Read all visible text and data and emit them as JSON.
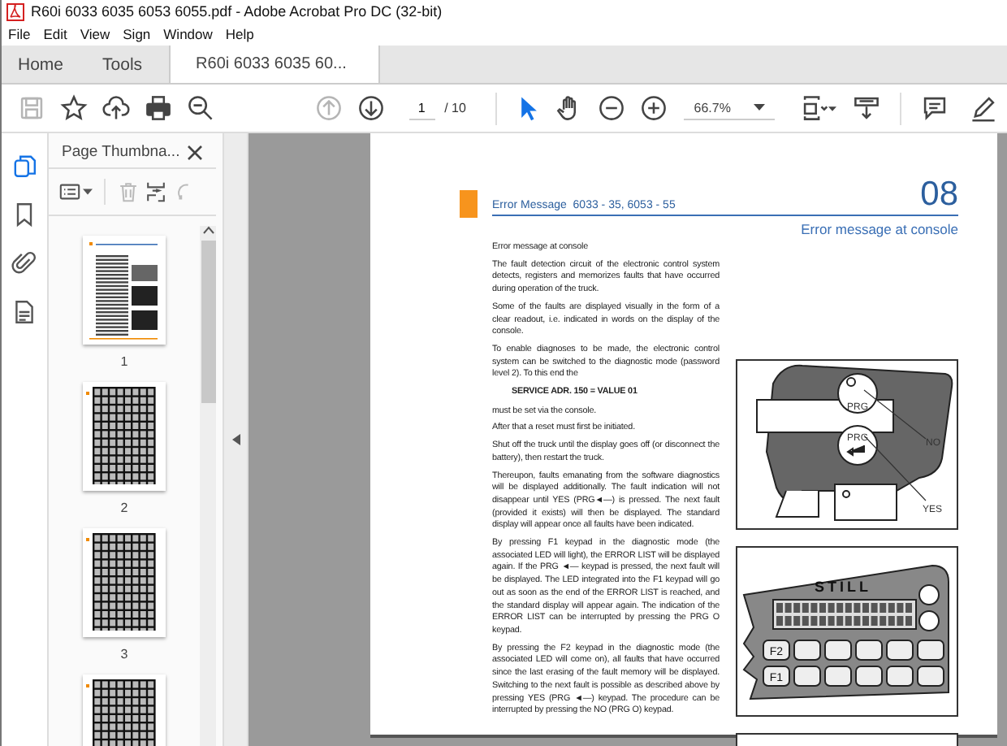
{
  "window": {
    "title": "R60i 6033 6035 6053 6055.pdf - Adobe Acrobat Pro DC (32-bit)"
  },
  "menu": [
    "File",
    "Edit",
    "View",
    "Sign",
    "Window",
    "Help"
  ],
  "tabs": [
    {
      "label": "Home",
      "selected": false,
      "kind": "nav"
    },
    {
      "label": "Tools",
      "selected": false,
      "kind": "nav"
    },
    {
      "label": "R60i 6033 6035 60...",
      "selected": true,
      "kind": "document"
    }
  ],
  "toolbar": {
    "left": [
      {
        "kind": "save",
        "disabled": true
      },
      {
        "kind": "star",
        "disabled": false
      },
      {
        "kind": "upload",
        "disabled": false
      },
      {
        "kind": "print",
        "disabled": false
      },
      {
        "kind": "search",
        "disabled": false
      }
    ],
    "nav": [
      {
        "kind": "previous-page",
        "disabled": true
      },
      {
        "kind": "next-page",
        "disabled": false
      }
    ],
    "page_field": {
      "value": "1"
    },
    "page_total": "/ 10",
    "tools": [
      {
        "kind": "select",
        "selected": true
      },
      {
        "kind": "hand",
        "selected": false
      }
    ],
    "zoom": [
      {
        "kind": "zoom-out"
      },
      {
        "kind": "zoom-in"
      }
    ],
    "zoom_field": {
      "value": "66.7%"
    },
    "right": [
      {
        "kind": "page-display"
      },
      {
        "kind": "scroll"
      },
      {
        "kind": "comment"
      },
      {
        "kind": "pen"
      }
    ]
  },
  "side_rail": [
    {
      "kind": "thumbnails",
      "selected": true
    },
    {
      "kind": "bookmarks",
      "selected": false
    },
    {
      "kind": "attachments",
      "selected": false
    },
    {
      "kind": "document",
      "selected": false
    }
  ],
  "thumbnails_panel": {
    "title": "Page Thumbna...",
    "tools": [
      {
        "kind": "options",
        "disabled": false
      },
      {
        "kind": "delete",
        "disabled": true
      },
      {
        "kind": "insert",
        "disabled": false
      },
      {
        "kind": "rotate",
        "disabled": true
      }
    ],
    "pages": [
      {
        "label": "1",
        "kind": "text"
      },
      {
        "label": "2",
        "kind": "table"
      },
      {
        "label": "3",
        "kind": "table"
      },
      {
        "kind": "table"
      }
    ]
  },
  "document": {
    "header": "Error Message  6033 - 35, 6053 - 55",
    "chapter": "08",
    "subtitle": "Error message at console",
    "paragraphs": [
      {
        "kind": "text",
        "text": "Error message at console"
      },
      {
        "kind": "text",
        "text": "The fault detection circuit of the electronic control system detects, registers and memorizes faults that have occurred during operation of the truck."
      },
      {
        "kind": "text",
        "text": "Some of the faults are displayed visually in the form of a clear readout, i.e. indicated in words on the display of the console."
      },
      {
        "kind": "text",
        "text": "To enable diagnoses to be made, the electronic control system can be switched to the diagnostic mode (password level 2). To this end the"
      },
      {
        "kind": "command",
        "text": "SERVICE ADR. 150 = VALUE 01"
      },
      {
        "kind": "text",
        "text": "must be set via the console."
      },
      {
        "kind": "text",
        "text": "After that a reset must first be initiated."
      },
      {
        "kind": "text",
        "text": "Shut off the truck until the display goes off (or disconnect the battery), then restart the truck."
      },
      {
        "kind": "text",
        "text": "Thereupon, faults emanating from the software diagnostics will be displayed additionally. The fault indication will not disappear until YES (PRG◄—) is pressed. The next fault (provided it exists) will then be displayed. The standard display will appear once all faults have been indicated."
      },
      {
        "kind": "text",
        "text": "By pressing F1 keypad in the diagnostic mode (the associated LED will light), the ERROR LIST will be displayed again. If the PRG ◄— keypad is pressed, the next fault will be displayed. The LED integrated into the F1 keypad will go out as soon as the end of the ERROR LIST is reached, and the standard display will appear again. The indication of the ERROR LIST can be interrupted by pressing the PRG O keypad."
      },
      {
        "kind": "text",
        "text": "By pressing the F2 keypad in the diagnostic mode (the associated LED will come on), all faults that have occurred since the last erasing of the fault memory will be displayed. Switching to the next fault is possible as described above by pressing YES (PRG ◄—) keypad. The procedure can be interrupted by pressing the NO (PRG O) keypad."
      }
    ],
    "figures": [
      {
        "kind": "keypad",
        "prg_top": "PRG",
        "prg_bottom": "PRG",
        "no": "NO",
        "yes": "YES"
      },
      {
        "kind": "console",
        "brand": "STILL",
        "key_top": "F2",
        "key_bottom": "F1"
      },
      {
        "kind": "blank"
      }
    ]
  }
}
